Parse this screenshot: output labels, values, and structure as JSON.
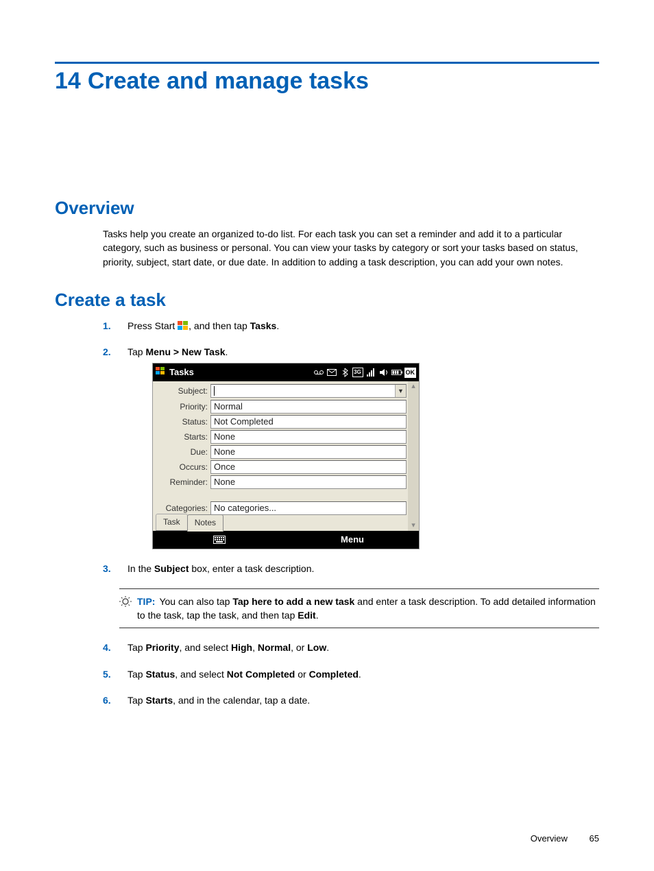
{
  "chapter": {
    "number": "14",
    "title": "Create and manage tasks"
  },
  "sections": {
    "overview": {
      "heading": "Overview",
      "body": "Tasks help you create an organized to-do list. For each task you can set a reminder and add it to a particular category, such as business or personal. You can view your tasks by category or sort your tasks based on status, priority, subject, start date, or due date. In addition to adding a task description, you can add your own notes."
    },
    "create": {
      "heading": "Create a task",
      "steps": {
        "s1": {
          "num": "1.",
          "a": "Press Start ",
          "b": ", and then tap ",
          "tasks": "Tasks",
          "c": "."
        },
        "s2": {
          "num": "2.",
          "a": "Tap ",
          "menu": "Menu > New Task",
          "b": "."
        },
        "s3": {
          "num": "3.",
          "a": "In the ",
          "subject": "Subject",
          "b": " box, enter a task description."
        },
        "s4": {
          "num": "4.",
          "a": "Tap ",
          "priority": "Priority",
          "b": ", and select ",
          "high": "High",
          "c": ", ",
          "normal": "Normal",
          "d": ", or ",
          "low": "Low",
          "e": "."
        },
        "s5": {
          "num": "5.",
          "a": "Tap ",
          "status": "Status",
          "b": ", and select ",
          "nc": "Not Completed",
          "c": " or ",
          "comp": "Completed",
          "d": "."
        },
        "s6": {
          "num": "6.",
          "a": "Tap ",
          "starts": "Starts",
          "b": ", and in the calendar, tap a date."
        }
      }
    }
  },
  "tip": {
    "label": "TIP:",
    "a": "You can also tap ",
    "taphere": "Tap here to add a new task",
    "b": " and enter a task description. To add detailed information to the task, tap the task, and then tap ",
    "edit": "Edit",
    "c": "."
  },
  "device": {
    "title": "Tasks",
    "ok": "OK",
    "fields": {
      "subject": {
        "label": "Subject:",
        "value": ""
      },
      "priority": {
        "label": "Priority:",
        "value": "Normal"
      },
      "status": {
        "label": "Status:",
        "value": "Not Completed"
      },
      "starts": {
        "label": "Starts:",
        "value": "None"
      },
      "due": {
        "label": "Due:",
        "value": "None"
      },
      "occurs": {
        "label": "Occurs:",
        "value": "Once"
      },
      "reminder": {
        "label": "Reminder:",
        "value": "None"
      },
      "categories": {
        "label": "Categories:",
        "value": "No categories..."
      }
    },
    "tabs": {
      "task": "Task",
      "notes": "Notes"
    },
    "menu": "Menu"
  },
  "footer": {
    "section": "Overview",
    "page": "65"
  }
}
